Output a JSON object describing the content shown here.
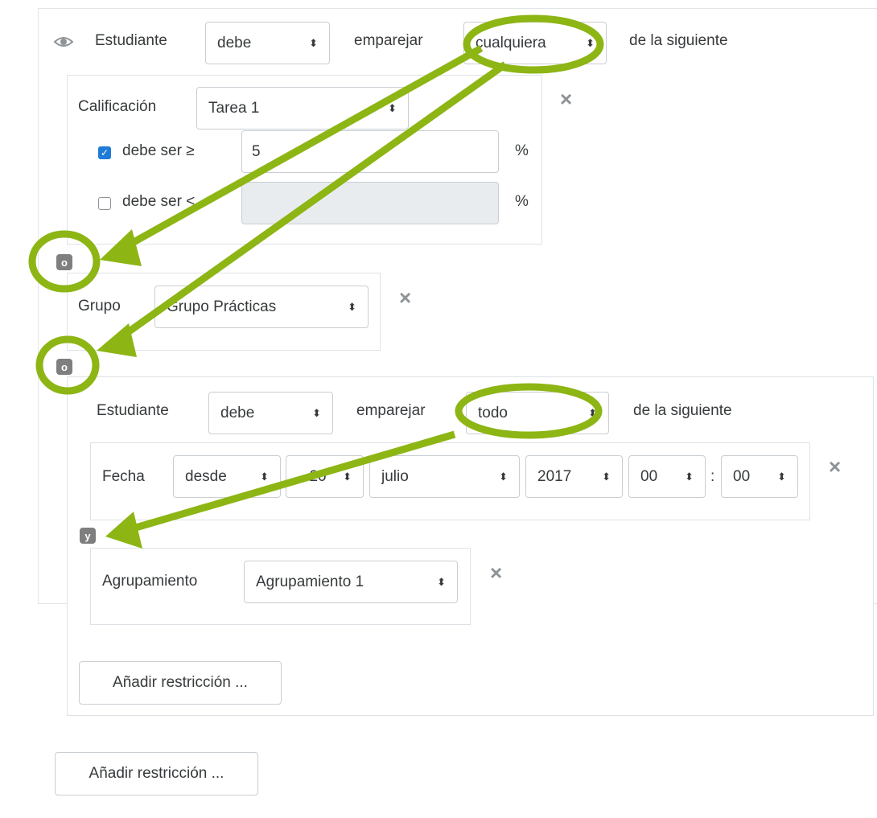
{
  "outer": {
    "subject": "Estudiante",
    "must": "debe",
    "match": "emparejar",
    "mode": "cualquiera",
    "tail": "de la siguiente"
  },
  "grade": {
    "label": "Calificación",
    "item": "Tarea 1",
    "min_label": "debe ser ≥",
    "min_value": "5",
    "min_checked": true,
    "max_label": "debe ser <",
    "max_value": "",
    "max_checked": false,
    "unit": "%"
  },
  "connector_or": "o",
  "group": {
    "label": "Grupo",
    "value": "Grupo Prácticas"
  },
  "inner": {
    "subject": "Estudiante",
    "must": "debe",
    "match": "emparejar",
    "mode": "todo",
    "tail": "de la siguiente"
  },
  "date": {
    "label": "Fecha",
    "direction": "desde",
    "day": "20",
    "month": "julio",
    "year": "2017",
    "hour": "00",
    "sep": ":",
    "minute": "00"
  },
  "connector_and": "y",
  "grouping": {
    "label": "Agrupamiento",
    "value": "Agrupamiento 1"
  },
  "add_restriction": "Añadir restricción ...",
  "icons": {
    "eye": "eye-icon",
    "close": "close-icon",
    "arrows": "select-arrows-icon"
  },
  "colors": {
    "annotation": "#8db514",
    "checkbox": "#1f7bd8",
    "badge": "#7f7f7f"
  }
}
